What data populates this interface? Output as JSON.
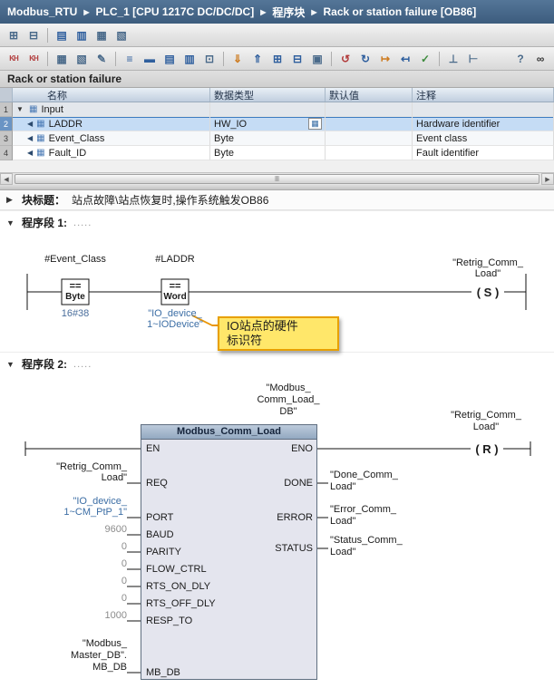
{
  "breadcrumb": {
    "separator": "▶",
    "items": [
      "Modbus_RTU",
      "PLC_1 [CPU 1217C DC/DC/DC]",
      "程序块",
      "Rack or station failure [OB86]"
    ]
  },
  "toolbars": {
    "top": [
      {
        "name": "insert-row-icon",
        "glyph": "⊞"
      },
      {
        "name": "add-row-below-icon",
        "glyph": "⊟"
      },
      {
        "name": "reset-start-values-icon",
        "glyph": "▤"
      },
      {
        "name": "snapshot-icon",
        "glyph": "▥"
      },
      {
        "name": "copy-snapshot-icon",
        "glyph": "▦"
      },
      {
        "name": "load-values-icon",
        "glyph": "▧"
      }
    ],
    "main": [
      {
        "name": "absolute-operands-icon",
        "glyph": "KH"
      },
      {
        "name": "symbolic-operands-icon",
        "glyph": "KH"
      },
      {
        "name": "insert-row-icon",
        "glyph": "▦"
      },
      {
        "name": "delete-row-icon",
        "glyph": "▧"
      },
      {
        "name": "edit-mode-icon",
        "glyph": "✎"
      },
      {
        "name": "network-list-icon",
        "glyph": "≡"
      },
      {
        "name": "insert-network-icon",
        "glyph": "▬"
      },
      {
        "name": "expand-networks-icon",
        "glyph": "▤"
      },
      {
        "name": "collapse-networks-icon",
        "glyph": "▥"
      },
      {
        "name": "comment-icon",
        "glyph": "⊡"
      },
      {
        "name": "download-to-device-icon",
        "glyph": "⇓"
      },
      {
        "name": "upload-from-device-icon",
        "glyph": "⇑"
      },
      {
        "name": "insert-box-icon",
        "glyph": "⊞"
      },
      {
        "name": "delete-box-icon",
        "glyph": "⊟"
      },
      {
        "name": "ladder-elements-icon",
        "glyph": "▣"
      },
      {
        "name": "go-online-icon",
        "glyph": "↺"
      },
      {
        "name": "go-offline-icon",
        "glyph": "↻"
      },
      {
        "name": "goto-next-icon",
        "glyph": "↦"
      },
      {
        "name": "goto-prev-icon",
        "glyph": "↤"
      },
      {
        "name": "consistency-check-icon",
        "glyph": "✓"
      },
      {
        "name": "open-branch-icon",
        "glyph": "⊥"
      },
      {
        "name": "close-branch-icon",
        "glyph": "⊢"
      },
      {
        "name": "help-icon",
        "glyph": "?"
      },
      {
        "name": "monitoring-glasses-icon",
        "glyph": "∞"
      }
    ]
  },
  "block_header": {
    "title": "Rack or station failure"
  },
  "interface_table": {
    "expander": "▼",
    "row_icon": "▦",
    "row_marker": "◀",
    "browse_glyph": "▦",
    "columns": [
      "名称",
      "数据类型",
      "默认值",
      "注释"
    ],
    "rows": [
      {
        "num": "1",
        "name": "Input",
        "type": "",
        "default": "",
        "comment": ""
      },
      {
        "num": "2",
        "name": "LADDR",
        "type": "HW_IO",
        "default": "",
        "comment": "Hardware identifier"
      },
      {
        "num": "3",
        "name": "Event_Class",
        "type": "Byte",
        "default": "",
        "comment": "Event class"
      },
      {
        "num": "4",
        "name": "Fault_ID",
        "type": "Byte",
        "default": "",
        "comment": "Fault identifier"
      }
    ]
  },
  "scrollbar": {
    "left": "◀",
    "right": "▶",
    "grip": "Ⅲ"
  },
  "block_title_row": {
    "toggle": "▶",
    "label": "块标题：",
    "text": "站点故障\\站点恢复时,操作系统触发OB86"
  },
  "network1": {
    "toggle": "▼",
    "title": "程序段 1:",
    "comment_dots": ".....",
    "contact1": {
      "label": "#Event_Class",
      "op": "==",
      "dtype": "Byte",
      "value": "16#38"
    },
    "contact2": {
      "label": "#LADDR",
      "op": "==",
      "dtype": "Word",
      "value1": "\"IO_device_",
      "value2": "1~IODevice\""
    },
    "coil": {
      "line1": "\"Retrig_Comm_",
      "line2": "Load\"",
      "symbol": "( S )"
    },
    "callout": {
      "line1": "IO站点的硬件",
      "line2": "标识符"
    }
  },
  "network2": {
    "toggle": "▼",
    "title": "程序段 2:",
    "comment_dots": ".....",
    "db_line1": "\"Modbus_",
    "db_line2": "Comm_Load_",
    "db_line3": "DB\"",
    "block_title": "Modbus_Comm_Load",
    "pins_left": [
      "EN",
      "REQ",
      "PORT",
      "BAUD",
      "PARITY",
      "FLOW_CTRL",
      "RTS_ON_DLY",
      "RTS_OFF_DLY",
      "RESP_TO",
      "MB_DB"
    ],
    "pins_right": [
      "ENO",
      "DONE",
      "ERROR",
      "STATUS"
    ],
    "req_op1": "\"Retrig_Comm_",
    "req_op2": "Load\"",
    "port_op1": "\"IO_device_",
    "port_op2": "1~CM_PtP_1\"",
    "baud_val": "9600",
    "parity_val": "0",
    "flow_val": "0",
    "rts_on_val": "0",
    "rts_off_val": "0",
    "resp_val": "1000",
    "mbdb_op1": "\"Modbus_",
    "mbdb_op2": "Master_DB\".",
    "mbdb_op3": "MB_DB",
    "done_op1": "\"Done_Comm_",
    "done_op2": "Load\"",
    "error_op1": "\"Error_Comm_",
    "error_op2": "Load\"",
    "status_op1": "\"Status_Comm_",
    "status_op2": "Load\"",
    "coil": {
      "line1": "\"Retrig_Comm_",
      "line2": "Load\"",
      "symbol": "( R )"
    }
  }
}
